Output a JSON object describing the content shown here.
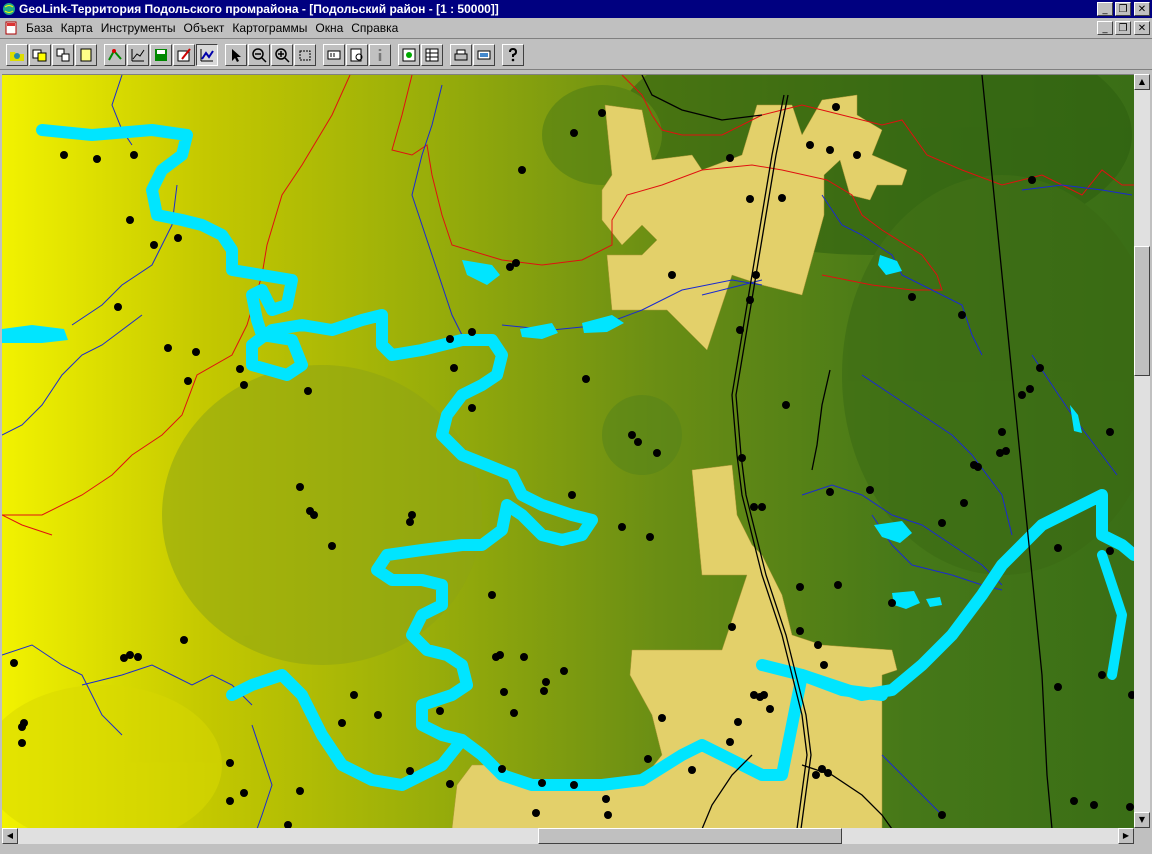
{
  "window": {
    "title": "GeoLink-Территория Подольского промрайона - [Подольский район - [1 : 50000]]",
    "controls": [
      "_",
      "❐",
      "✕"
    ]
  },
  "menu": {
    "items": [
      {
        "label": "База"
      },
      {
        "label": "Карта"
      },
      {
        "label": "Инструменты"
      },
      {
        "label": "Объект"
      },
      {
        "label": "Картограммы"
      },
      {
        "label": "Окна"
      },
      {
        "label": "Справка"
      }
    ],
    "doc_controls": [
      "_",
      "❐",
      "✕"
    ]
  },
  "toolbar": {
    "groups": [
      [
        "open-database-icon",
        "copy-layer-icon",
        "layers-icon",
        "map-sheet-icon"
      ],
      [
        "point-edit-icon",
        "chart-icon",
        "save-icon",
        "table-edit-icon",
        "legend-icon"
      ],
      [
        "select-arrow-icon",
        "zoom-out-icon",
        "zoom-in-icon",
        "zoom-window-icon"
      ],
      [
        "label-icon",
        "find-icon",
        "info-icon"
      ],
      [
        "add-object-icon",
        "table-icon"
      ],
      [
        "print-icon",
        "export-icon"
      ],
      [
        "help-icon"
      ]
    ],
    "pressed": [
      "legend-icon"
    ]
  },
  "map": {
    "scale": "1 : 50000",
    "colors": {
      "background_low": "#f0f000",
      "background_high": "#2f6b10",
      "river": "#00e5ff",
      "urban": "#e3d06a",
      "stream": "#1a2ad0",
      "boundary": "#e01010",
      "railway": "#000000",
      "wells": "#000000"
    }
  }
}
